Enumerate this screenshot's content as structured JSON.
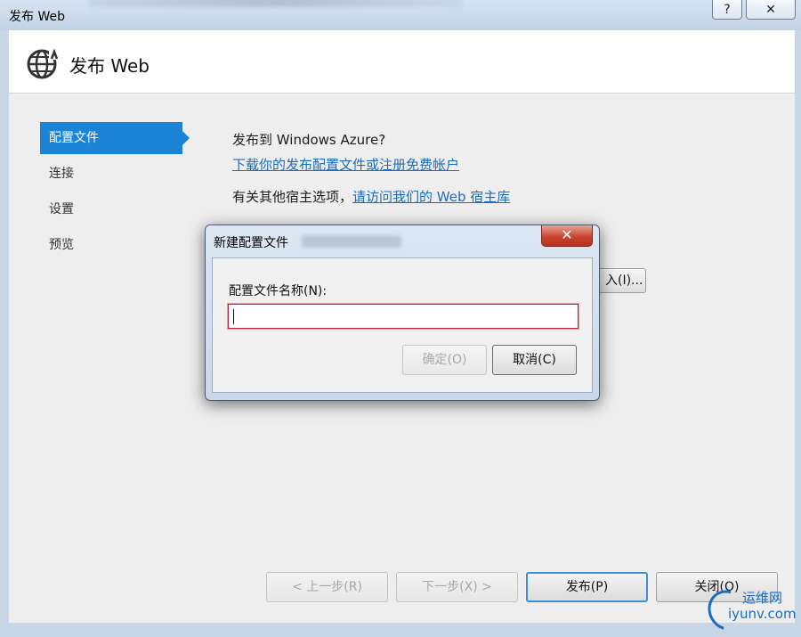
{
  "window": {
    "title": "发布 Web",
    "help_glyph": "?",
    "close_glyph": "✕"
  },
  "header": {
    "title": "发布 Web",
    "icon": "globe-publish-icon"
  },
  "sidebar": {
    "items": [
      {
        "label": "配置文件",
        "active": true
      },
      {
        "label": "连接"
      },
      {
        "label": "设置"
      },
      {
        "label": "预览"
      }
    ]
  },
  "main": {
    "publish_to": "发布到 Windows Azure?",
    "download_link": "下载你的发布配置文件或注册免费帐户",
    "other_hosts_prefix": "有关其他宿主选项，",
    "other_hosts_link": "请访问我们的 Web 宿主库",
    "import_button": "入(I)..."
  },
  "buttons": {
    "prev": "< 上一步(R)",
    "next": "下一步(X) >",
    "publish": "发布(P)",
    "close": "关闭(O)"
  },
  "dialog": {
    "title": "新建配置文件",
    "close_glyph": "✕",
    "field_label": "配置文件名称(N):",
    "field_value": "",
    "ok_button": "确定(O)",
    "cancel_button": "取消(C)"
  },
  "watermark": {
    "text_top": "运维网",
    "text_bottom": "iyunv.com"
  },
  "colors": {
    "accent": "#1c84d7",
    "link": "#1a6cc1",
    "dialog_close": "#c9452f"
  }
}
